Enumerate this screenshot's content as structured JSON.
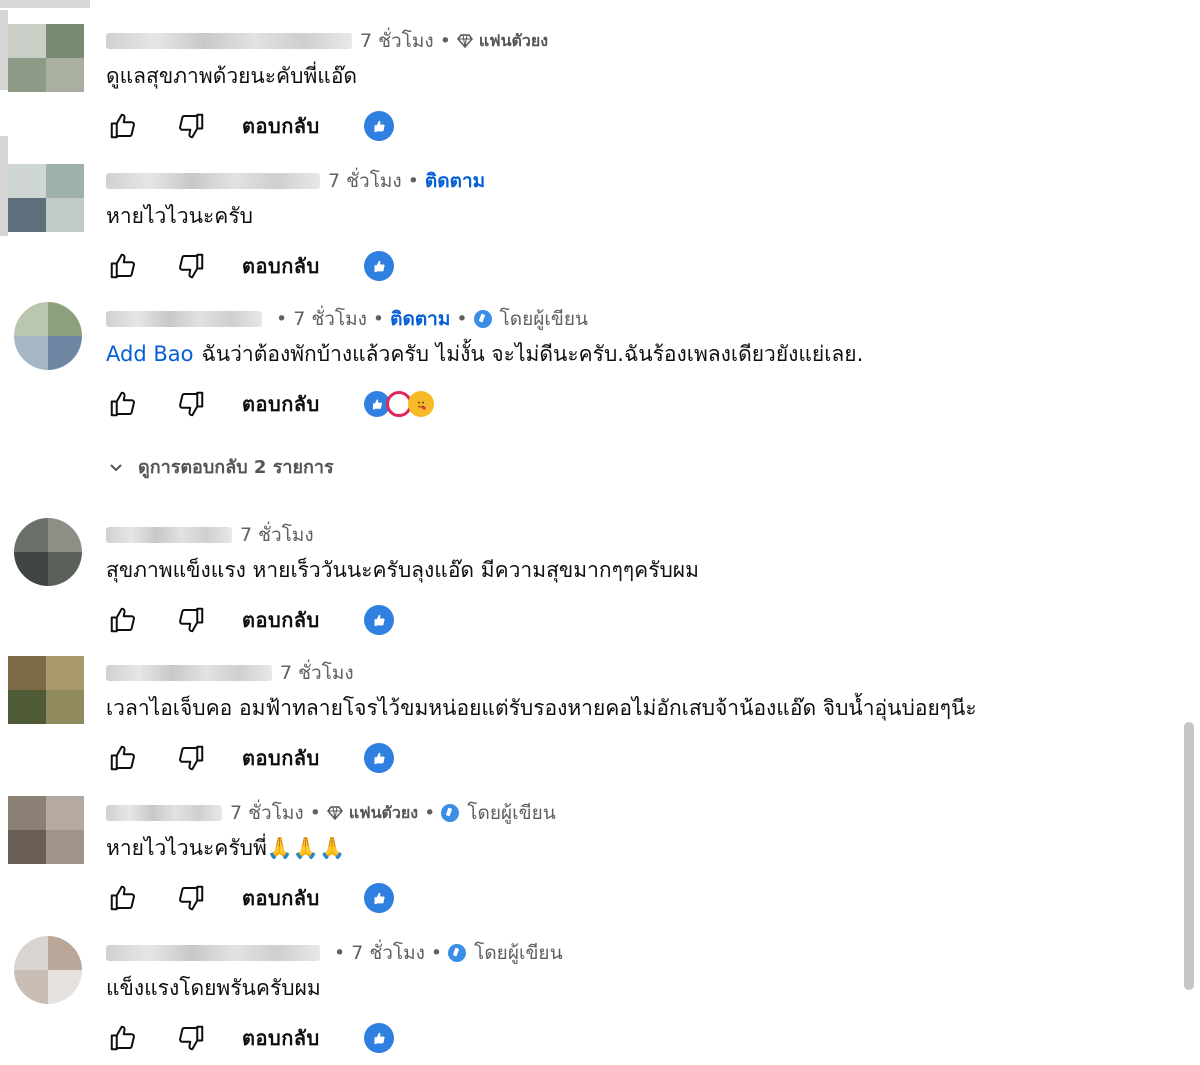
{
  "comments": [
    {
      "time": "7 ชั่วโมง",
      "badge": "แฟนตัวยง",
      "follow": "",
      "by_author": "",
      "mention": "",
      "text": "ดูแลสุขภาพด้วยนะคับพี่แอ๊ด",
      "reply_label": "ตอบกลับ"
    },
    {
      "time": "7 ชั่วโมง",
      "badge": "",
      "follow": "ติดตาม",
      "by_author": "",
      "mention": "",
      "text": "หายไวไวนะครับ",
      "reply_label": "ตอบกลับ"
    },
    {
      "time": "7 ชั่วโมง",
      "badge": "",
      "follow": "ติดตาม",
      "by_author": "โดยผู้เขียน",
      "mention": "Add Bao",
      "text": "ฉันว่าต้องพักบ้างแล้วครับ ไม่งั้น จะไม่ดีนะครับ.ฉันร้องเพลงเดียวยังแย่เลย.",
      "reply_label": "ตอบกลับ"
    },
    {
      "time": "7 ชั่วโมง",
      "badge": "",
      "follow": "",
      "by_author": "",
      "mention": "",
      "text": "สุขภาพแข็งแรง หายเร็ววันนะครับลุงแอ๊ด มีความสุขมากๆๆครับผม",
      "reply_label": "ตอบกลับ"
    },
    {
      "time": "7 ชั่วโมง",
      "badge": "",
      "follow": "",
      "by_author": "",
      "mention": "",
      "text": "เวลาไอเจ็บคอ อมฟ้าทลายโจรไว้ขมหน่อยแต่รับรองหายคอไม่อักเสบจ้าน้องแอ๊ด จิบน้ำอุ่นบ่อยๆนีะ",
      "reply_label": "ตอบกลับ"
    },
    {
      "time": "7 ชั่วโมง",
      "badge": "แฟนตัวยง",
      "follow": "",
      "by_author": "โดยผู้เขียน",
      "mention": "",
      "text": "หายไวไวนะครับพี่🙏🙏🙏",
      "reply_label": "ตอบกลับ"
    },
    {
      "time": "7 ชั่วโมง",
      "badge": "",
      "follow": "",
      "by_author": "โดยผู้เขียน",
      "mention": "",
      "text": "แข็งแรงโดยพรันครับผม",
      "reply_label": "ตอบกลับ"
    }
  ],
  "view_replies": "ดูการตอบกลับ 2 รายการ",
  "icons": {
    "like": "thumb-up-icon",
    "dislike": "thumb-down-icon",
    "creator_heart": "creator-heart-icon",
    "chevron": "chevron-down-icon",
    "fan_badge": "gem-icon",
    "author_badge": "author-badge-icon"
  },
  "colors": {
    "link": "#065fd4",
    "muted": "#606060",
    "heart_badge": "#2f80e0"
  }
}
